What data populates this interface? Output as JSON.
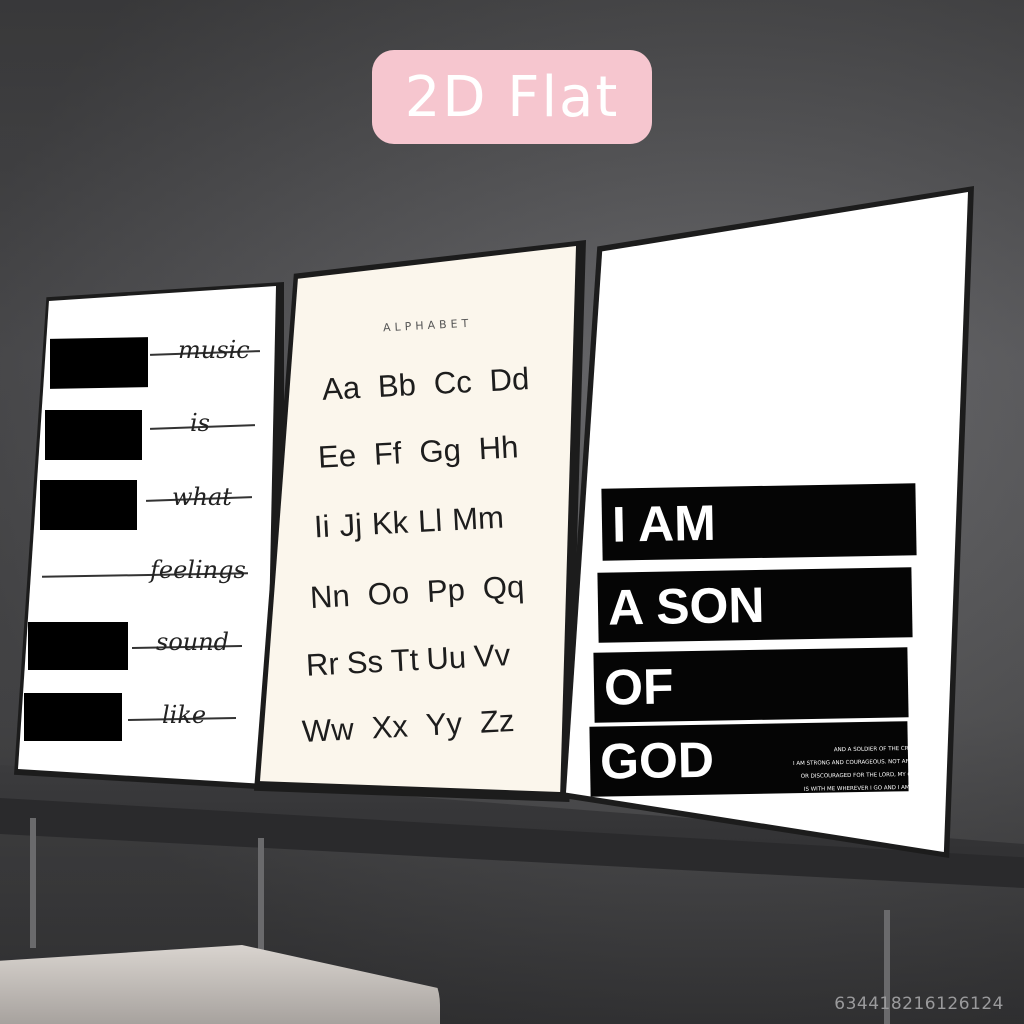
{
  "badge": {
    "label": "2D Flat"
  },
  "posters": {
    "music": {
      "words": [
        "music",
        "is",
        "what",
        "feelings",
        "sound",
        "like"
      ]
    },
    "alphabet": {
      "title": "ALPHABET",
      "rows": [
        [
          "Aa",
          "Bb",
          "Cc",
          "Dd"
        ],
        [
          "Ee",
          "Ff",
          "Gg",
          "Hh"
        ],
        [
          "Ii",
          "Jj",
          "Kk",
          "Ll",
          "Mm"
        ],
        [
          "Nn",
          "Oo",
          "Pp",
          "Qq"
        ],
        [
          "Rr",
          "Ss",
          "Tt",
          "Uu",
          "Vv"
        ],
        [
          "Ww",
          "Xx",
          "Yy",
          "Zz"
        ]
      ]
    },
    "son_of_god": {
      "lines": [
        "I AM",
        "A SON",
        "OF",
        "GOD"
      ],
      "verse": [
        "AND A SOLDIER OF THE CROSS.",
        "I AM STRONG AND COURAGEOUS. NOT AFRAID",
        "OR DISCOURAGED FOR THE LORD, MY GOD,",
        "IS WITH ME WHEREVER I GO AND I AM HIS."
      ]
    }
  },
  "watermark": "634418216126124"
}
